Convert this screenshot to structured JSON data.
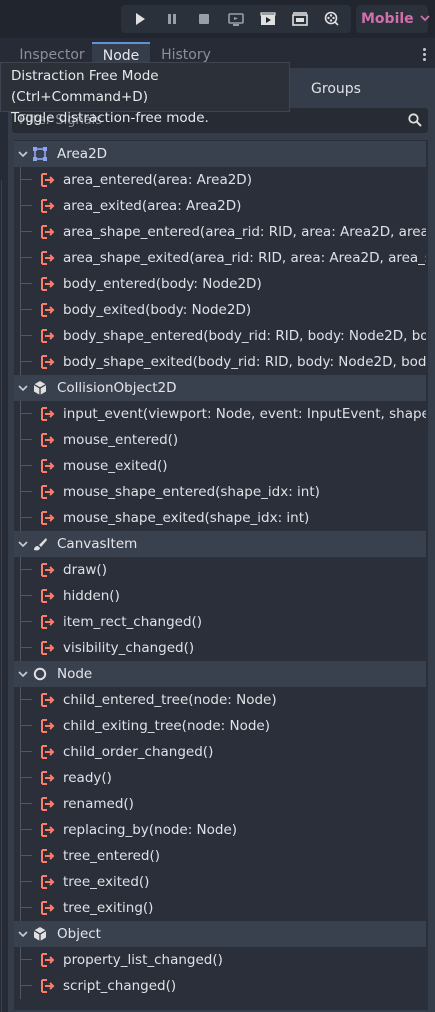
{
  "toolbar": {
    "buttons": [
      "play-icon",
      "pause-icon",
      "stop-icon",
      "remote-debug-icon",
      "play-scene-icon",
      "play-custom-scene-icon",
      "movie-maker-icon"
    ],
    "renderer": "Mobile"
  },
  "dock_tabs": [
    "Inspector",
    "Node",
    "History"
  ],
  "active_tab": "Node",
  "subtabs": {
    "groups": "Groups"
  },
  "filter": {
    "placeholder": "Filter Signals"
  },
  "tooltip": {
    "line1": "Distraction Free Mode (Ctrl+Command+D)",
    "line2": "Toggle distraction-free mode."
  },
  "categories": [
    {
      "name": "Area2D",
      "icon": "area2d-icon",
      "signals": [
        "area_entered(area: Area2D)",
        "area_exited(area: Area2D)",
        "area_shape_entered(area_rid: RID, area: Area2D, area...",
        "area_shape_exited(area_rid: RID, area: Area2D, area_s...",
        "body_entered(body: Node2D)",
        "body_exited(body: Node2D)",
        "body_shape_entered(body_rid: RID, body: Node2D, bo...",
        "body_shape_exited(body_rid: RID, body: Node2D, bod..."
      ]
    },
    {
      "name": "CollisionObject2D",
      "icon": "collision-object-icon",
      "signals": [
        "input_event(viewport: Node, event: InputEvent, shape...",
        "mouse_entered()",
        "mouse_exited()",
        "mouse_shape_entered(shape_idx: int)",
        "mouse_shape_exited(shape_idx: int)"
      ]
    },
    {
      "name": "CanvasItem",
      "icon": "canvas-item-icon",
      "signals": [
        "draw()",
        "hidden()",
        "item_rect_changed()",
        "visibility_changed()"
      ]
    },
    {
      "name": "Node",
      "icon": "node-icon",
      "signals": [
        "child_entered_tree(node: Node)",
        "child_exiting_tree(node: Node)",
        "child_order_changed()",
        "ready()",
        "renamed()",
        "replacing_by(node: Node)",
        "tree_entered()",
        "tree_exited()",
        "tree_exiting()"
      ]
    },
    {
      "name": "Object",
      "icon": "object-icon",
      "signals": [
        "property_list_changed()",
        "script_changed()"
      ]
    }
  ],
  "colors": {
    "signal_icon": "#ff7b6a",
    "category_icon": "#8da5f3",
    "renderer": "#d16fad",
    "active_tab_accent": "#5f93d6"
  }
}
